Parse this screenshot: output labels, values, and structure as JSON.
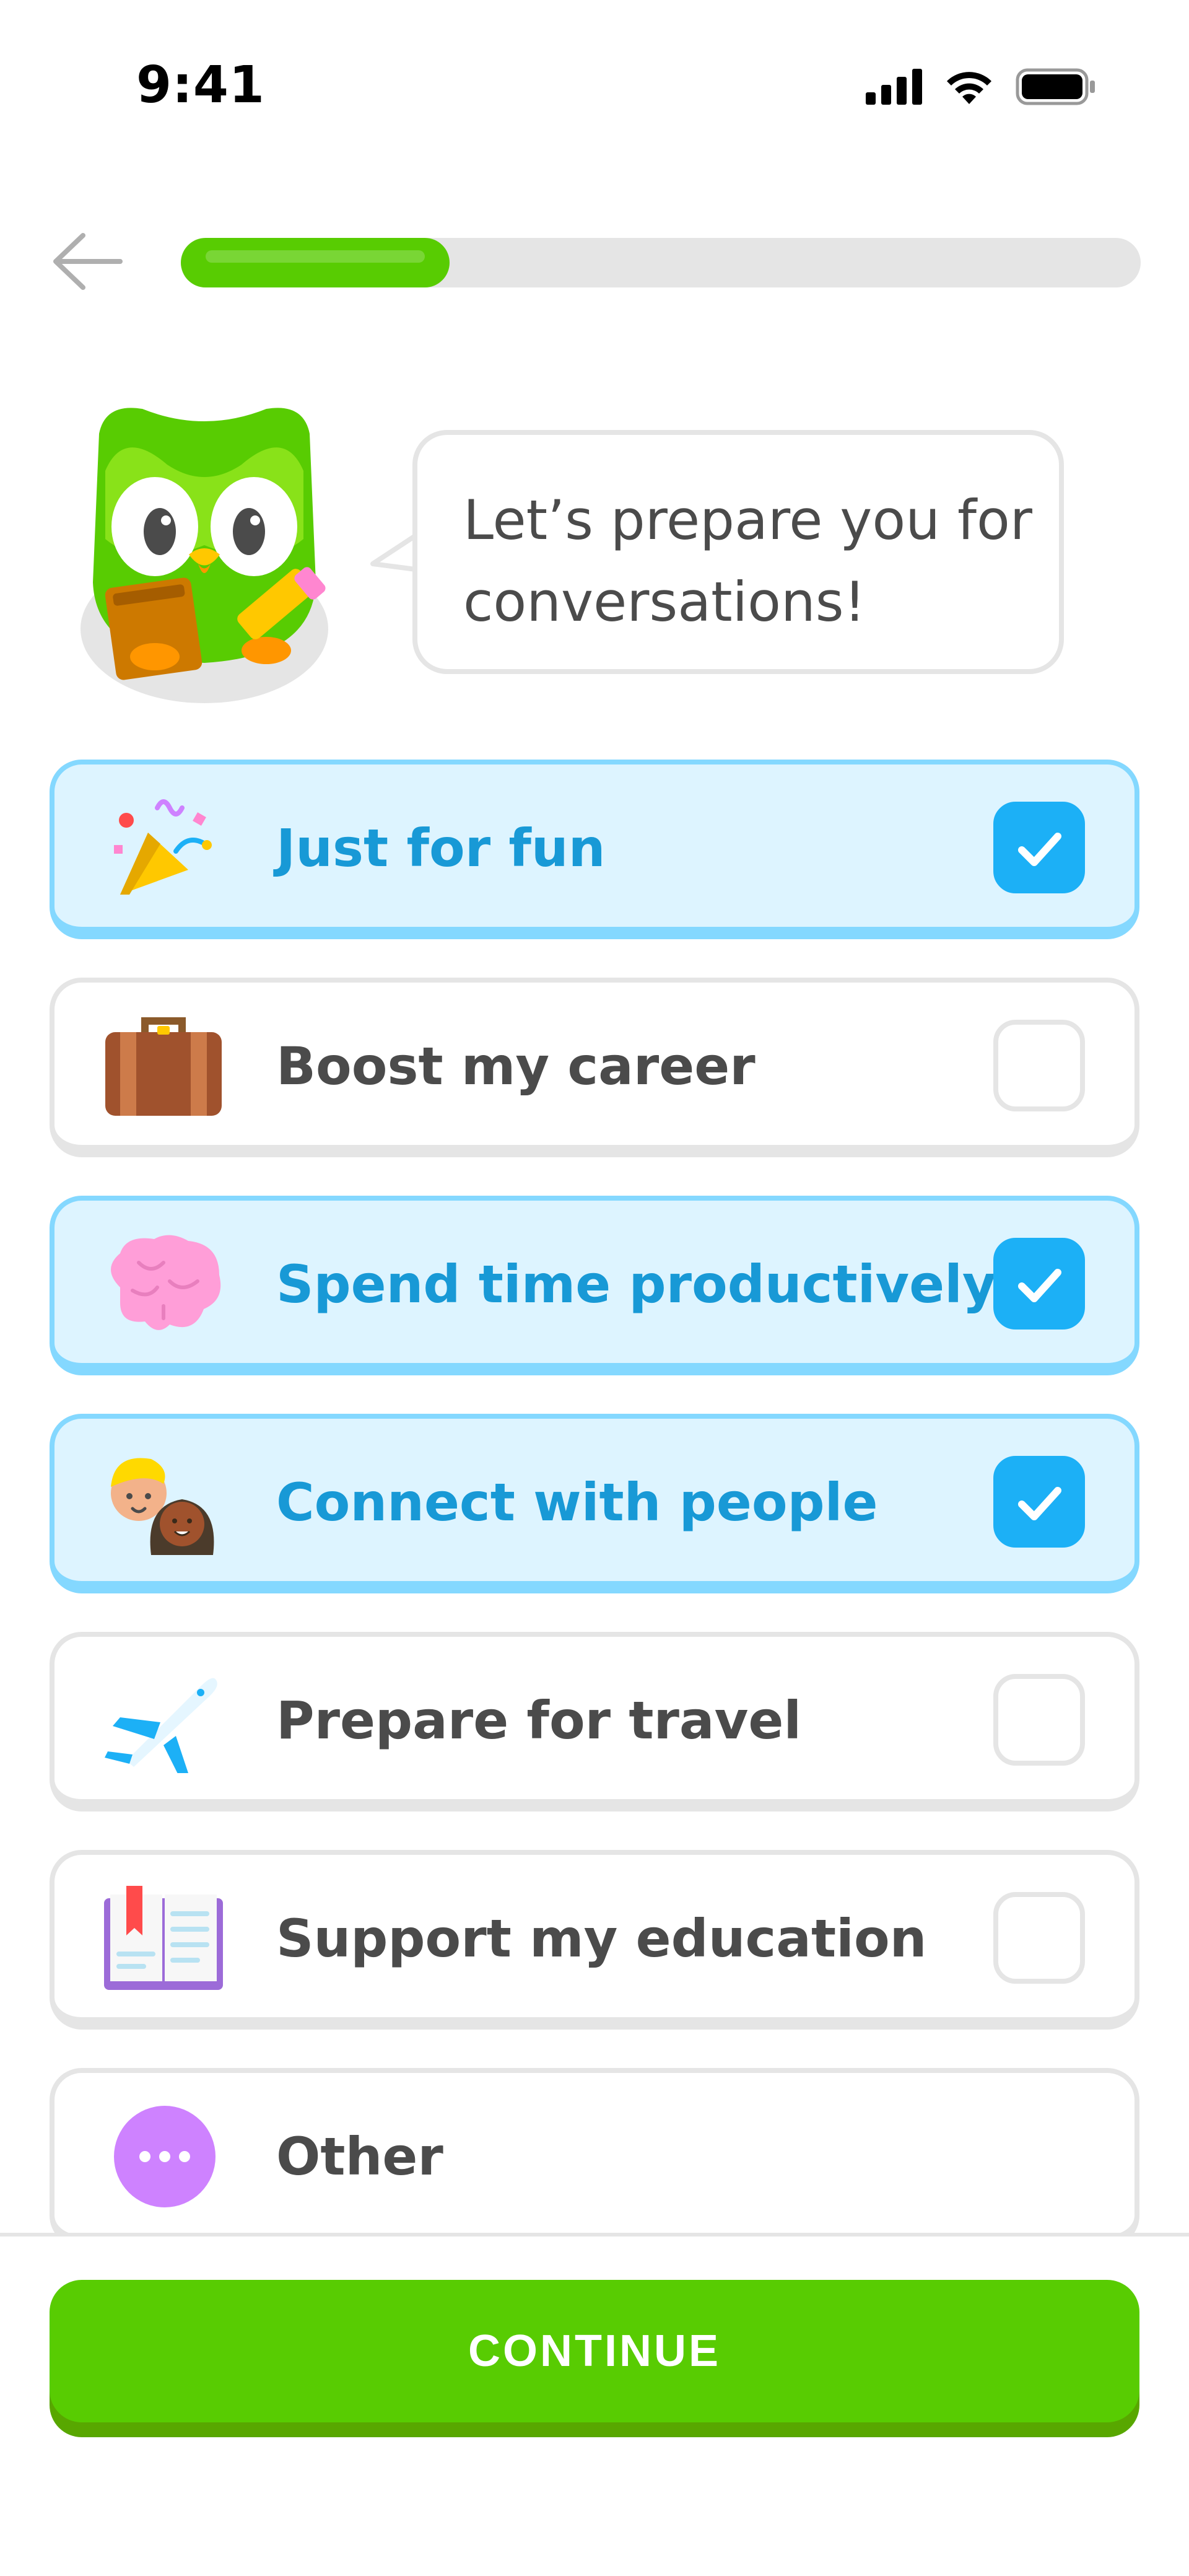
{
  "status_bar": {
    "time": "9:41",
    "icons": [
      "cellular-signal-icon",
      "wifi-icon",
      "battery-icon"
    ]
  },
  "header": {
    "back_icon": "arrow-left-icon",
    "progress": 0.28
  },
  "mascot": {
    "icon": "owl-mascot-icon",
    "message": "Let’s prepare you for conversations!"
  },
  "options": [
    {
      "label": "Just for fun",
      "icon": "party-popper-icon",
      "selected": true
    },
    {
      "label": "Boost my career",
      "icon": "briefcase-icon",
      "selected": false
    },
    {
      "label": "Spend time productively",
      "icon": "brain-icon",
      "selected": true
    },
    {
      "label": "Connect with people",
      "icon": "people-icon",
      "selected": true
    },
    {
      "label": "Prepare for travel",
      "icon": "airplane-icon",
      "selected": false
    },
    {
      "label": "Support my education",
      "icon": "open-book-icon",
      "selected": false
    },
    {
      "label": "Other",
      "icon": "more-dots-icon",
      "selected": false
    }
  ],
  "footer": {
    "continue_label": "CONTINUE"
  },
  "colors": {
    "brand_green": "#58cc02",
    "selected_blue": "#1cb0f6",
    "selected_bg": "#ddf4ff",
    "text_gray": "#4b4b4b"
  }
}
